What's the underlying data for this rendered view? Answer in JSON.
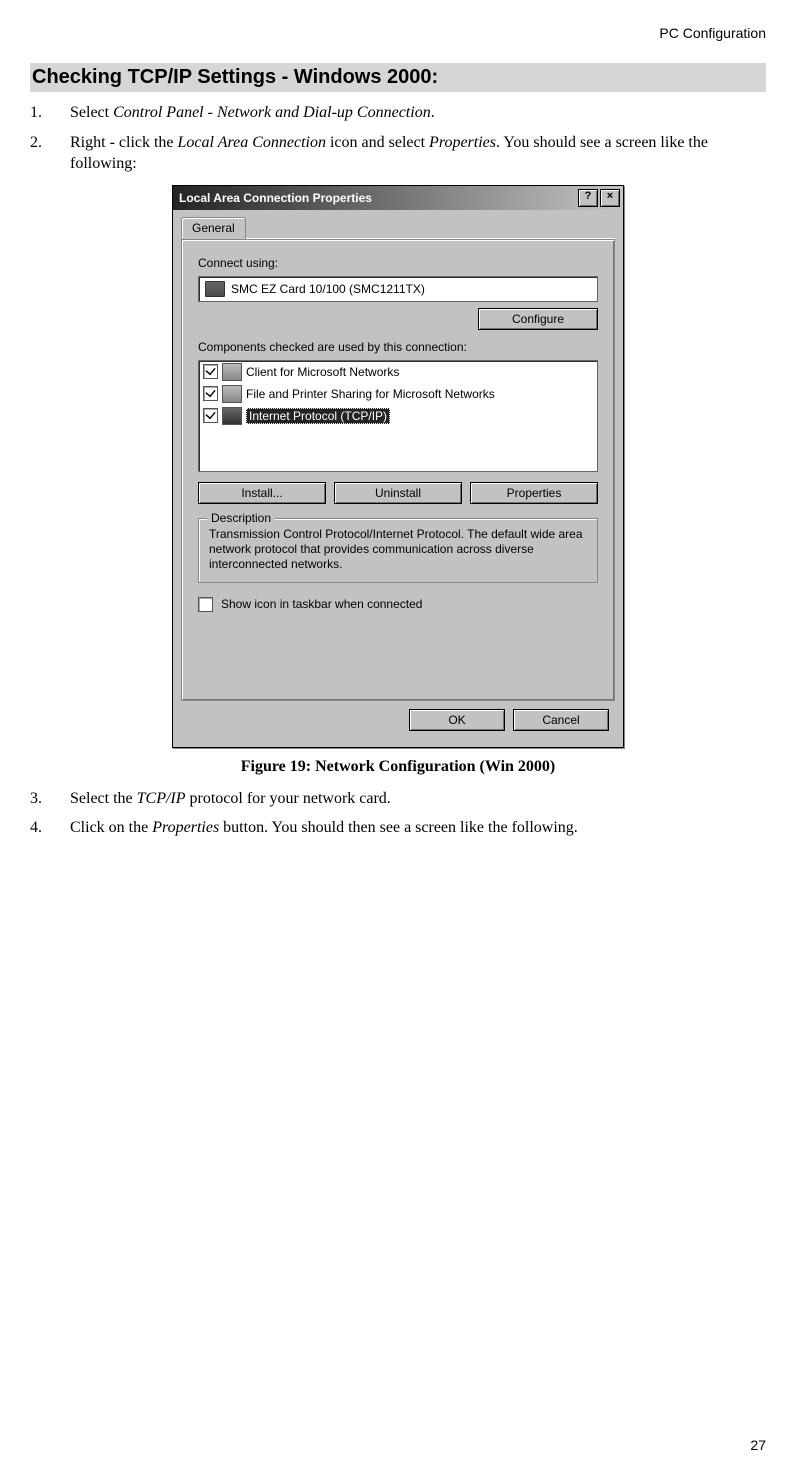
{
  "header": {
    "right": "PC Configuration"
  },
  "heading": "Checking TCP/IP Settings - Windows 2000:",
  "steps": {
    "s1_pre": "Select ",
    "s1_em": "Control Panel - Network and Dial-up Connection",
    "s1_post": ".",
    "s2_pre": "Right - click the ",
    "s2_em1": "Local Area Connection",
    "s2_mid": " icon and select ",
    "s2_em2": "Properties",
    "s2_post": ". You should see a screen like the following:",
    "s3_pre": "Select the ",
    "s3_em": "TCP/IP",
    "s3_post": " protocol for your network card.",
    "s4_pre": "Click on the ",
    "s4_em": "Properties",
    "s4_post": " button. You should then see a screen like the following."
  },
  "dialog": {
    "title": "Local Area Connection Properties",
    "help_btn": "?",
    "close_btn": "×",
    "tab": "General",
    "connect_using_label": "Connect using:",
    "adapter": "SMC EZ Card 10/100 (SMC1211TX)",
    "configure_btn": "Configure",
    "components_label": "Components checked are used by this connection:",
    "items": [
      {
        "label": "Client for Microsoft Networks",
        "checked": true,
        "selected": false
      },
      {
        "label": "File and Printer Sharing for Microsoft Networks",
        "checked": true,
        "selected": false
      },
      {
        "label": "Internet Protocol (TCP/IP)",
        "checked": true,
        "selected": true
      }
    ],
    "install_btn": "Install...",
    "uninstall_btn": "Uninstall",
    "properties_btn": "Properties",
    "desc_legend": "Description",
    "desc_text": "Transmission Control Protocol/Internet Protocol. The default wide area network protocol that provides communication across diverse interconnected networks.",
    "show_icon_label": "Show icon in taskbar when connected",
    "ok_btn": "OK",
    "cancel_btn": "Cancel"
  },
  "figure_caption": "Figure 19: Network Configuration (Win 2000)",
  "page_number": "27"
}
